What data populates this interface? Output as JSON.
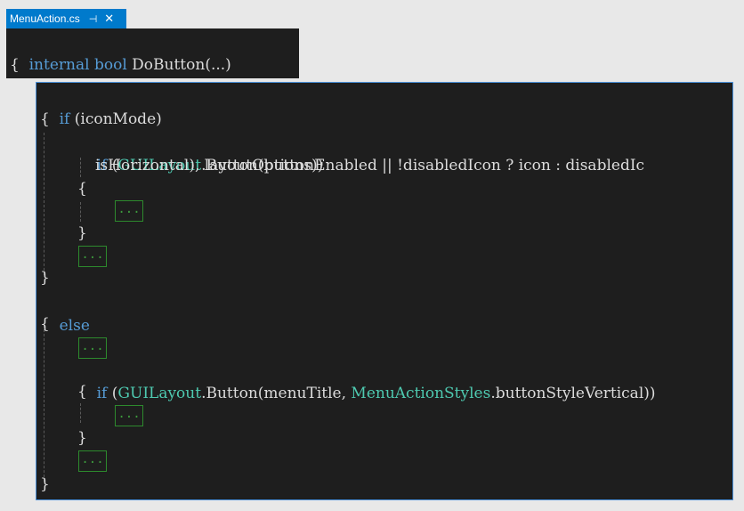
{
  "tab": {
    "title": "MenuAction.cs",
    "pin_glyph": "⊣",
    "close_glyph": "✕"
  },
  "peek1": {
    "line1": {
      "kw1": "internal",
      "kw2": "bool",
      "rest": "DoButton(...)"
    },
    "line2": "{"
  },
  "peek2": {
    "if_kw": "if",
    "if_cond": "(iconMode)",
    "open1": "{",
    "line_if2_kw": "if",
    "line_if2_paren": "(",
    "guilayout1": "GUILayout",
    "line_if2_rest": ".Button(buttonEnabled || !disabledIcon ? icon : disabledIc",
    "line_wrap": "isHorizontal), layoutOptions))",
    "open2": "{",
    "collapsed1": "...",
    "close2": "}",
    "collapsed2": "...",
    "close1": "}",
    "else_kw": "else",
    "open3": "{",
    "collapsed3": "...",
    "line_if3_kw": "if",
    "line_if3_paren": "(",
    "guilayout2": "GUILayout",
    "line_if3_mid": ".Button(menuTitle, ",
    "menu_styles": "MenuActionStyles",
    "line_if3_end": ".buttonStyleVertical))",
    "open4": "{",
    "collapsed4": "...",
    "close4": "}",
    "collapsed5": "...",
    "close3": "}"
  },
  "colors": {
    "keyword": "#569cd6",
    "type": "#4ec9b0",
    "text": "#dcdcdc",
    "collapsed": "#3d9b3d",
    "tab": "#007acc"
  }
}
